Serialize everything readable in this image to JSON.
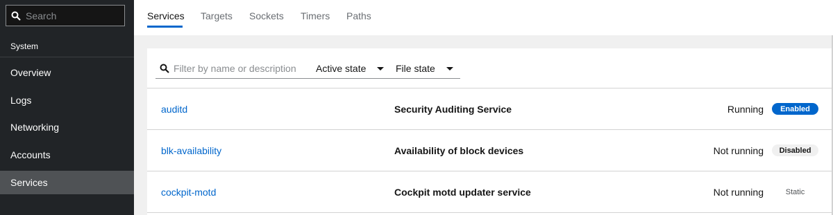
{
  "sidebar": {
    "search_placeholder": "Search",
    "section_label": "System",
    "items": [
      {
        "label": "Overview"
      },
      {
        "label": "Logs"
      },
      {
        "label": "Networking"
      },
      {
        "label": "Accounts"
      },
      {
        "label": "Services"
      }
    ],
    "active_item": "Services"
  },
  "tabs": [
    {
      "label": "Services"
    },
    {
      "label": "Targets"
    },
    {
      "label": "Sockets"
    },
    {
      "label": "Timers"
    },
    {
      "label": "Paths"
    }
  ],
  "active_tab": "Services",
  "toolbar": {
    "filter_placeholder": "Filter by name or description",
    "active_state_label": "Active state",
    "file_state_label": "File state"
  },
  "services": [
    {
      "name": "auditd",
      "description": "Security Auditing Service",
      "state": "Running",
      "file_state": "Enabled"
    },
    {
      "name": "blk-availability",
      "description": "Availability of block devices",
      "state": "Not running",
      "file_state": "Disabled"
    },
    {
      "name": "cockpit-motd",
      "description": "Cockpit motd updater service",
      "state": "Not running",
      "file_state": "Static"
    }
  ],
  "colors": {
    "accent": "#0066cc",
    "sidebar_bg": "#212427",
    "sidebar_active": "#4f5255"
  },
  "icons": {
    "search": "search-icon",
    "caret": "caret-down-icon"
  }
}
